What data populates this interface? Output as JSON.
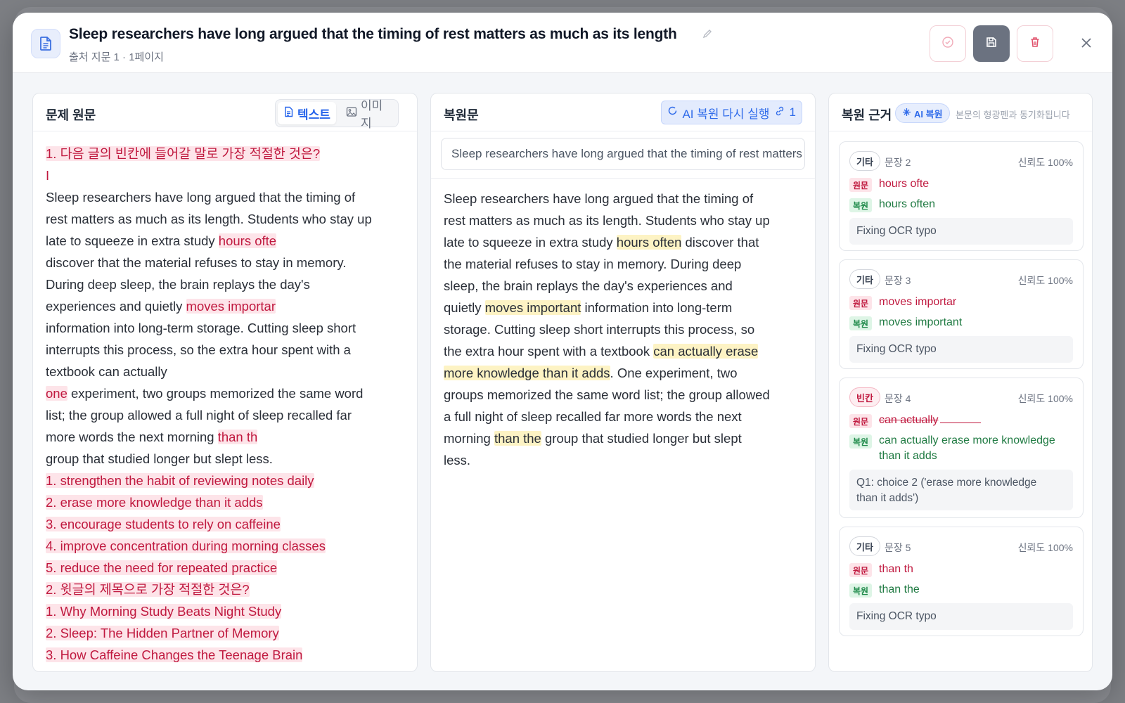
{
  "header": {
    "title": "Sleep researchers have long argued that the timing of rest matters as much as its length",
    "subtitle": "출처 지문 1 · 1페이지"
  },
  "source_panel": {
    "title": "문제 원문",
    "tab_text": "텍스트",
    "tab_image": "이미지",
    "lines": [
      {
        "type": "pink",
        "parts": [
          {
            "t": "1. 다음 글의 빈칸에 들어갈 말로 가장 적절한 것은?",
            "hl": true
          }
        ]
      },
      {
        "type": "pink",
        "parts": [
          {
            "t": "I",
            "hl": false
          }
        ]
      },
      {
        "type": "plain",
        "parts": [
          {
            "t": "Sleep researchers have long argued that the timing of",
            "hl": false
          }
        ]
      },
      {
        "type": "plain",
        "parts": [
          {
            "t": "rest matters as much as its length. Students who stay up",
            "hl": false
          }
        ]
      },
      {
        "type": "plain",
        "parts": [
          {
            "t": "late to squeeze in extra study ",
            "hl": false
          },
          {
            "t": "hours ofte",
            "hl": true
          }
        ]
      },
      {
        "type": "plain",
        "parts": [
          {
            "t": "discover that the material refuses to stay in memory.",
            "hl": false
          }
        ]
      },
      {
        "type": "plain",
        "parts": [
          {
            "t": "During deep sleep, the brain replays the day's",
            "hl": false
          }
        ]
      },
      {
        "type": "plain",
        "parts": [
          {
            "t": "experiences and quietly ",
            "hl": false
          },
          {
            "t": "moves importar",
            "hl": true
          }
        ]
      },
      {
        "type": "plain",
        "parts": [
          {
            "t": "information into long-term storage. Cutting sleep short",
            "hl": false
          }
        ]
      },
      {
        "type": "plain",
        "parts": [
          {
            "t": "interrupts this process, so the extra hour spent with a",
            "hl": false
          }
        ]
      },
      {
        "type": "plain",
        "parts": [
          {
            "t": "textbook can actually",
            "hl": false
          }
        ]
      },
      {
        "type": "plain",
        "parts": [
          {
            "t": "one",
            "hl": true
          },
          {
            "t": " experiment, two groups memorized the same word",
            "hl": false
          }
        ]
      },
      {
        "type": "plain",
        "parts": [
          {
            "t": "list; the group allowed a full night of sleep recalled far",
            "hl": false
          }
        ]
      },
      {
        "type": "plain",
        "parts": [
          {
            "t": "more words the next morning ",
            "hl": false
          },
          {
            "t": "than th",
            "hl": true
          }
        ]
      },
      {
        "type": "plain",
        "parts": [
          {
            "t": "group that studied longer but slept less.",
            "hl": false
          }
        ]
      },
      {
        "type": "pink",
        "parts": [
          {
            "t": "1. strengthen the habit of reviewing notes daily",
            "hl": true
          }
        ]
      },
      {
        "type": "pink",
        "parts": [
          {
            "t": "2. erase more knowledge than it adds",
            "hl": true
          }
        ]
      },
      {
        "type": "pink",
        "parts": [
          {
            "t": "3. encourage students to rely on caffeine",
            "hl": true
          }
        ]
      },
      {
        "type": "pink",
        "parts": [
          {
            "t": "4. improve concentration during morning classes",
            "hl": true
          }
        ]
      },
      {
        "type": "pink",
        "parts": [
          {
            "t": "5. reduce the need for repeated practice",
            "hl": true
          }
        ]
      },
      {
        "type": "pink",
        "parts": [
          {
            "t": "2. 윗글의 제목으로 가장 적절한 것은?",
            "hl": true
          }
        ]
      },
      {
        "type": "pink",
        "parts": [
          {
            "t": "1. Why Morning Study Beats Night Study",
            "hl": true
          }
        ]
      },
      {
        "type": "pink",
        "parts": [
          {
            "t": "2. Sleep: The Hidden Partner of Memory",
            "hl": true
          }
        ]
      },
      {
        "type": "pink",
        "parts": [
          {
            "t": "3. How Caffeine Changes the Teenage Brain",
            "hl": true
          }
        ]
      }
    ]
  },
  "restored_panel": {
    "title": "복원문",
    "ai_rerun_label": "AI 복원 다시 실행",
    "link_count": "1",
    "search_value": "Sleep researchers have long argued that the timing of rest matters as much as its length",
    "lines": [
      [
        {
          "t": "Sleep researchers have long argued that the timing of",
          "hl": false
        }
      ],
      [
        {
          "t": "rest matters as much as its length. Students who stay up",
          "hl": false
        }
      ],
      [
        {
          "t": "late to squeeze in extra study ",
          "hl": false
        },
        {
          "t": "hours often",
          "hl": true
        },
        {
          "t": " discover that",
          "hl": false
        }
      ],
      [
        {
          "t": "the material refuses to stay in memory. During deep",
          "hl": false
        }
      ],
      [
        {
          "t": "sleep, the brain replays the day's experiences and",
          "hl": false
        }
      ],
      [
        {
          "t": "quietly ",
          "hl": false
        },
        {
          "t": "moves important",
          "hl": true
        },
        {
          "t": " information into long-term",
          "hl": false
        }
      ],
      [
        {
          "t": "storage. Cutting sleep short interrupts this process, so",
          "hl": false
        }
      ],
      [
        {
          "t": "the extra hour spent with a textbook ",
          "hl": false
        },
        {
          "t": "can actually erase",
          "hl": true
        }
      ],
      [
        {
          "t": "more knowledge than it adds",
          "hl": true
        },
        {
          "t": ". One experiment, two",
          "hl": false
        }
      ],
      [
        {
          "t": "groups memorized the same word list; the group allowed",
          "hl": false
        }
      ],
      [
        {
          "t": "a full night of sleep recalled far more words the next",
          "hl": false
        }
      ],
      [
        {
          "t": "morning ",
          "hl": false
        },
        {
          "t": "than the",
          "hl": true
        },
        {
          "t": " group that studied longer but slept",
          "hl": false
        }
      ],
      [
        {
          "t": "less.",
          "hl": false
        }
      ]
    ]
  },
  "evidence_panel": {
    "title": "복원 근거",
    "ai_badge": "AI 복원",
    "sync_note": "본문의 형광펜과 동기화됩니다",
    "original_label": "원문",
    "restored_label": "복원",
    "cards": [
      {
        "tag": "기타",
        "tag_color": "gray",
        "sentence": "문장 2",
        "confidence": "신뢰도 100%",
        "original": "hours ofte",
        "restored": "hours often",
        "restored_line2": "",
        "note": "Fixing OCR typo",
        "note_line2": ""
      },
      {
        "tag": "기타",
        "tag_color": "gray",
        "sentence": "문장 3",
        "confidence": "신뢰도 100%",
        "original": "moves importar",
        "restored": "moves important",
        "restored_line2": "",
        "note": "Fixing OCR typo",
        "note_line2": ""
      },
      {
        "tag": "빈칸",
        "tag_color": "red",
        "sentence": "문장 4",
        "confidence": "신뢰도 100%",
        "original": "can actually",
        "restored": "can actually erase more knowledge",
        "restored_line2": "than it adds",
        "note": "Q1: choice 2 ('erase more knowledge",
        "note_line2": "than it adds')"
      },
      {
        "tag": "기타",
        "tag_color": "gray",
        "sentence": "문장 5",
        "confidence": "신뢰도 100%",
        "original": "than th",
        "restored": "than the",
        "restored_line2": "",
        "note": "Fixing OCR typo",
        "note_line2": ""
      }
    ]
  },
  "colors": {
    "accent": "#2f6bea",
    "highlight_pink": "#fde4e9",
    "highlight_yellow": "#fdf3c4",
    "danger": "#c0193f",
    "success": "#1f7a42"
  }
}
